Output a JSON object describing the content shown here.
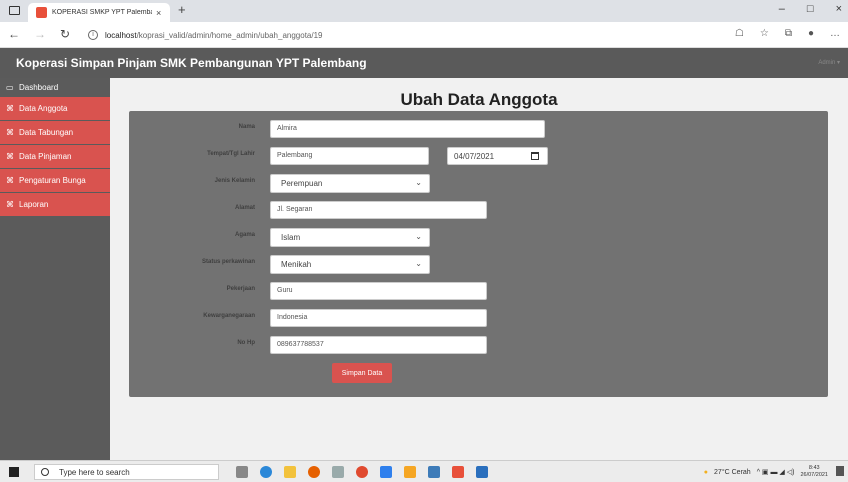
{
  "browser": {
    "tab_title": "KOPERASI SMKP YPT Palembang",
    "tab_close": "×",
    "new_tab": "+",
    "url_host": "localhost",
    "url_path": "/koprasi_valid/admin/home_admin/ubah_anggota/19",
    "controls": [
      "–",
      "□",
      "×"
    ]
  },
  "header": {
    "brand": "Koperasi Simpan Pinjam SMK Pembangunan YPT Palembang",
    "admin": "Admin ▾"
  },
  "sidebar": {
    "items": [
      {
        "label": "Dashboard",
        "icon": "laptop-icon"
      },
      {
        "label": "Data Anggota",
        "icon": "paperclip-icon"
      },
      {
        "label": "Data Tabungan",
        "icon": "paperclip-icon"
      },
      {
        "label": "Data Pinjaman",
        "icon": "paperclip-icon"
      },
      {
        "label": "Pengaturan Bunga",
        "icon": "paperclip-icon"
      },
      {
        "label": "Laporan",
        "icon": "paperclip-icon"
      }
    ]
  },
  "form": {
    "title": "Ubah Data Anggota",
    "fields": {
      "nama": {
        "label": "Nama",
        "value": "Almira"
      },
      "ttl": {
        "label": "Tempat/Tgl Lahir",
        "value": "Palembang",
        "date": "04/07/2021"
      },
      "jk": {
        "label": "Jenis Kelamin",
        "value": "Perempuan"
      },
      "alamat": {
        "label": "Alamat",
        "value": "Jl. Segaran"
      },
      "agama": {
        "label": "Agama",
        "value": "Islam"
      },
      "status": {
        "label": "Status perkawinan",
        "value": "Menikah"
      },
      "pekerjaan": {
        "label": "Pekerjaan",
        "value": "Guru"
      },
      "warga": {
        "label": "Kewarganegaraan",
        "value": "Indonesia"
      },
      "hp": {
        "label": "No Hp",
        "value": "089637788537"
      }
    },
    "submit": "Simpan Data"
  },
  "taskbar": {
    "search": "Type here to search",
    "weather": "27°C Cerah",
    "time": "8:43",
    "date": "26/07/2021"
  },
  "colors": {
    "accent": "#d9534f",
    "header": "#5a5a5a",
    "panel": "#727272"
  }
}
